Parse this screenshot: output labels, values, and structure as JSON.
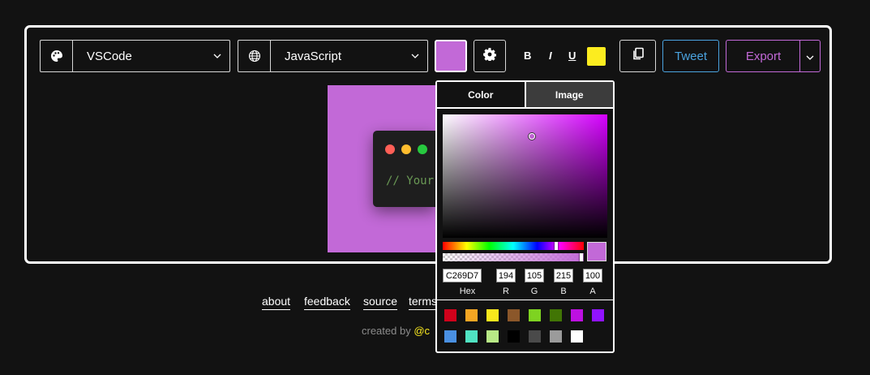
{
  "toolbar": {
    "theme_select": {
      "icon": "palette-icon",
      "value": "VSCode"
    },
    "language_select": {
      "icon": "globe-icon",
      "value": "JavaScript"
    },
    "bg_color": "#c269d7",
    "settings_icon": "gear-icon",
    "bold_label": "B",
    "italic_label": "I",
    "underline_label": "U",
    "highlight_color": "#fcec1f",
    "copy_icon": "clipboard-icon",
    "tweet_label": "Tweet",
    "export_label": "Export"
  },
  "preview": {
    "window_dots": [
      "#ff5f56",
      "#ffbd2e",
      "#27c93f"
    ],
    "code_placeholder": "// Your"
  },
  "color_picker": {
    "tabs": [
      {
        "label": "Color",
        "active": true
      },
      {
        "label": "Image",
        "active": false
      }
    ],
    "hex": "C269D7",
    "r": "194",
    "g": "105",
    "b": "215",
    "a": "100",
    "labels": {
      "hex": "Hex",
      "r": "R",
      "g": "G",
      "b": "B",
      "a": "A"
    },
    "presets": [
      "#d0021b",
      "#f5a623",
      "#f8e71c",
      "#8b572a",
      "#7ed321",
      "#417505",
      "#bd10e0",
      "#9013fe",
      "#4a90e2",
      "#50e3c2",
      "#b8e986",
      "#000000",
      "#4a4a4a",
      "#9b9b9b",
      "#ffffff"
    ]
  },
  "footer": {
    "links": [
      "about",
      "feedback",
      "source",
      "terms"
    ],
    "credit_prefix": "created by",
    "credit_handle": "@c"
  }
}
